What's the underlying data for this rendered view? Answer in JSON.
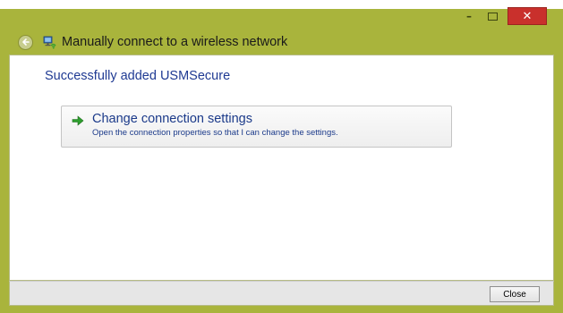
{
  "window": {
    "title": "Manually connect to a wireless network",
    "controls": {
      "minimize": "–",
      "close": "✕"
    }
  },
  "icons": {
    "back": "back-arrow-icon",
    "network": "wireless-network-icon",
    "command_arrow": "green-arrow-icon"
  },
  "content": {
    "heading": "Successfully added USMSecure",
    "command_link": {
      "title": "Change connection settings",
      "description": "Open the connection properties so that I can change the settings."
    }
  },
  "footer": {
    "close_label": "Close"
  },
  "colors": {
    "frame": "#a9b43c",
    "heading_text": "#1f3a93",
    "close_control": "#c9302c",
    "arrow": "#2e9e2e"
  }
}
